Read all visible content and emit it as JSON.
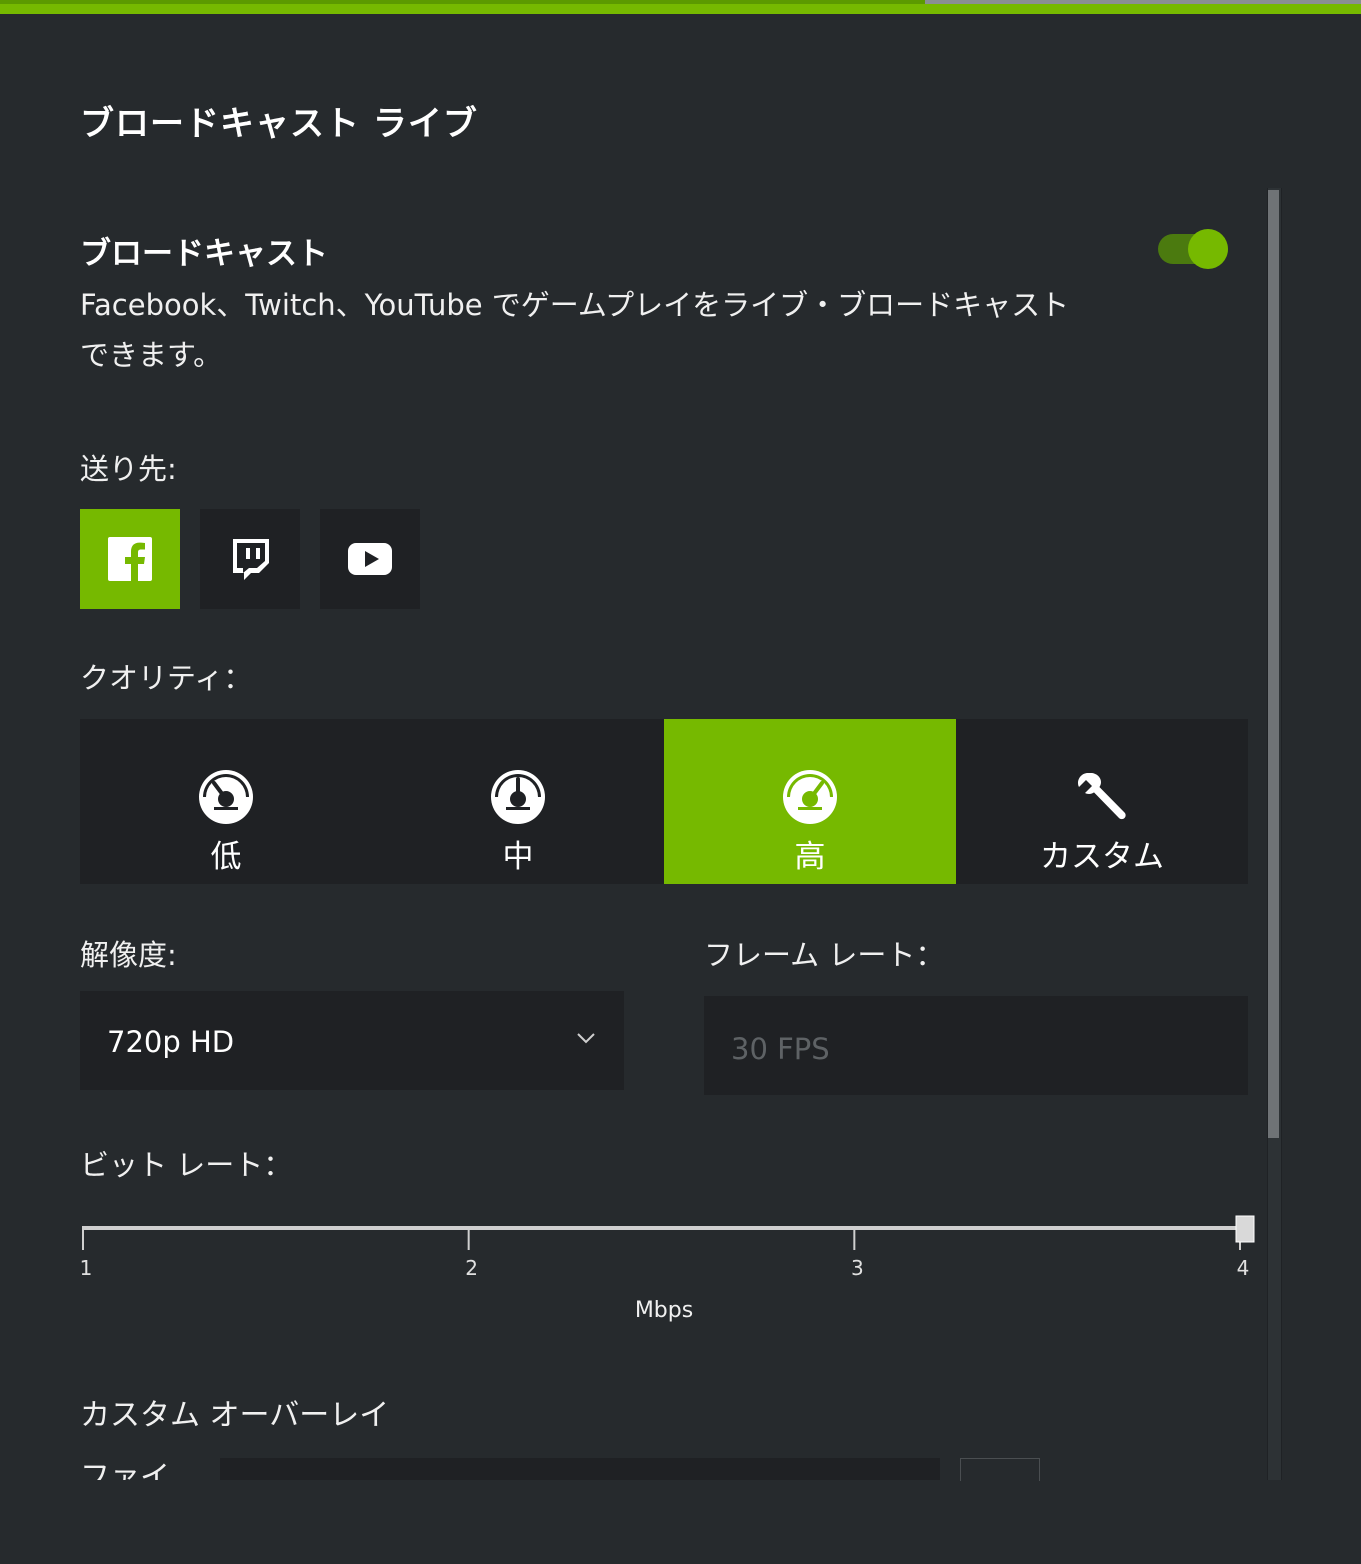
{
  "page": {
    "title": "ブロードキャスト ライブ"
  },
  "broadcast": {
    "title": "ブロードキャスト",
    "enabled": true,
    "description": "Facebook、Twitch、YouTube でゲームプレイをライブ・ブロードキャストできます。"
  },
  "destination": {
    "label": "送り先:",
    "selected": "facebook",
    "options": [
      {
        "id": "facebook",
        "icon": "facebook-icon"
      },
      {
        "id": "twitch",
        "icon": "twitch-icon"
      },
      {
        "id": "youtube",
        "icon": "youtube-icon"
      }
    ]
  },
  "quality": {
    "label": "クオリティ：",
    "selected": "high",
    "options": [
      {
        "id": "low",
        "label": "低",
        "icon": "gauge-low-icon"
      },
      {
        "id": "medium",
        "label": "中",
        "icon": "gauge-medium-icon"
      },
      {
        "id": "high",
        "label": "高",
        "icon": "gauge-high-icon"
      },
      {
        "id": "custom",
        "label": "カスタム",
        "icon": "wrench-icon"
      }
    ]
  },
  "resolution": {
    "label": "解像度:",
    "value": "720p HD"
  },
  "framerate": {
    "label": "フレーム レート：",
    "value": "30 FPS"
  },
  "bitrate": {
    "label": "ビット レート：",
    "min": 1,
    "max": 4,
    "value": 4,
    "ticks": [
      "1",
      "2",
      "3",
      "4"
    ],
    "unit": "Mbps"
  },
  "overlay": {
    "title": "カスタム オーバーレイ",
    "file_label": "ファイ"
  },
  "colors": {
    "accent": "#76b900",
    "background": "#262a2d",
    "panel": "#1f2124"
  }
}
